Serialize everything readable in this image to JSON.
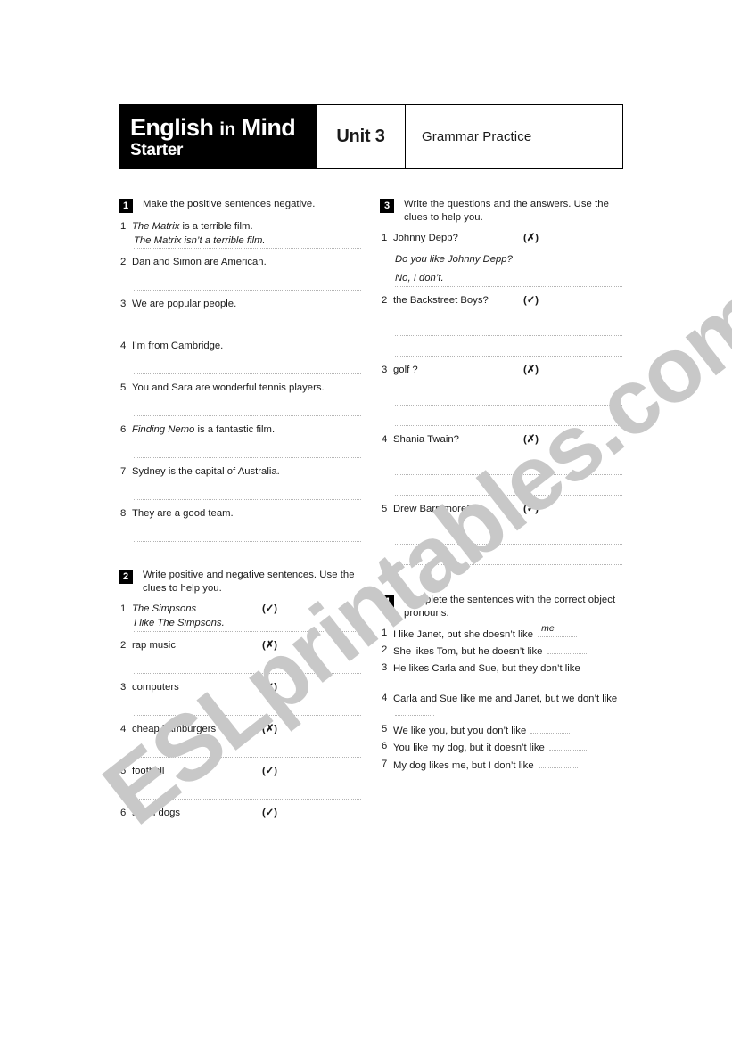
{
  "header": {
    "logo_line1_part1": "English",
    "logo_line1_in": "in",
    "logo_line1_part2": "Mind",
    "logo_line2": "Starter",
    "unit": "Unit 3",
    "title": "Grammar Practice"
  },
  "watermark": "ESLprintables.com",
  "marks": {
    "tick": "(✓)",
    "cross": "(✗)"
  },
  "exercises": [
    {
      "number": "1",
      "instruction": "Make the positive sentences negative.",
      "items": [
        {
          "num": "1",
          "text_pre": "The Matrix",
          "text_post": " is a terrible film.",
          "answer": "The Matrix isn’t a terrible film."
        },
        {
          "num": "2",
          "text_pre": "",
          "text_post": "Dan and Simon are American.",
          "answer": ""
        },
        {
          "num": "3",
          "text_pre": "",
          "text_post": "We are popular people.",
          "answer": ""
        },
        {
          "num": "4",
          "text_pre": "",
          "text_post": "I’m from Cambridge.",
          "answer": ""
        },
        {
          "num": "5",
          "text_pre": "",
          "text_post": "You and Sara are wonderful tennis players.",
          "answer": ""
        },
        {
          "num": "6",
          "text_pre": "Finding Nemo",
          "text_post": " is a fantastic film.",
          "answer": ""
        },
        {
          "num": "7",
          "text_pre": "",
          "text_post": "Sydney is the capital of Australia.",
          "answer": ""
        },
        {
          "num": "8",
          "text_pre": "",
          "text_post": "They are a good team.",
          "answer": ""
        }
      ]
    },
    {
      "number": "2",
      "instruction": "Write positive and negative sentences. Use the clues to help you.",
      "items": [
        {
          "num": "1",
          "text_pre": "The Simpsons",
          "text_post": "",
          "clue": "(✓)",
          "answer": "I like The Simpsons."
        },
        {
          "num": "2",
          "text_pre": "",
          "text_post": "rap music",
          "clue": "(✗)",
          "answer": ""
        },
        {
          "num": "3",
          "text_pre": "",
          "text_post": "computers",
          "clue": "(✓)",
          "answer": ""
        },
        {
          "num": "4",
          "text_pre": "",
          "text_post": "cheap hamburgers",
          "clue": "(✗)",
          "answer": ""
        },
        {
          "num": "5",
          "text_pre": "",
          "text_post": "football",
          "clue": "(✓)",
          "answer": ""
        },
        {
          "num": "6",
          "text_pre": "",
          "text_post": "small dogs",
          "clue": "(✓)",
          "answer": ""
        }
      ]
    },
    {
      "number": "3",
      "instruction": "Write the questions and the answers. Use the clues to help you.",
      "items": [
        {
          "num": "1",
          "text_pre": "",
          "text_post": "Johnny Depp?",
          "clue": "(✗)",
          "answer1": "Do you like Johnny Depp?",
          "answer2": "No, I don’t."
        },
        {
          "num": "2",
          "text_pre": "",
          "text_post": "the Backstreet Boys?",
          "clue": "(✓)",
          "answer1": "",
          "answer2": ""
        },
        {
          "num": "3",
          "text_pre": "",
          "text_post": "golf ?",
          "clue": "(✗)",
          "answer1": "",
          "answer2": ""
        },
        {
          "num": "4",
          "text_pre": "",
          "text_post": "Shania Twain?",
          "clue": "(✗)",
          "answer1": "",
          "answer2": ""
        },
        {
          "num": "5",
          "text_pre": "",
          "text_post": "Drew Barrymore?",
          "clue": "(✓)",
          "answer1": "",
          "answer2": ""
        }
      ]
    },
    {
      "number": "4",
      "instruction": "Complete the sentences with the correct object pronouns.",
      "items": [
        {
          "num": "1",
          "text": "I like Janet, but she doesn’t like",
          "answer": "me"
        },
        {
          "num": "2",
          "text": "She likes Tom, but he doesn’t like",
          "answer": ""
        },
        {
          "num": "3",
          "text": "He likes Carla and Sue, but they don’t like",
          "answer": ""
        },
        {
          "num": "4",
          "text": "Carla and Sue like me and Janet, but we don’t like",
          "answer": ""
        },
        {
          "num": "5",
          "text": "We like you, but you don’t like",
          "answer": ""
        },
        {
          "num": "6",
          "text": "You like my dog, but it doesn’t like",
          "answer": ""
        },
        {
          "num": "7",
          "text": "My dog likes me, but I don’t like",
          "answer": ""
        }
      ]
    }
  ]
}
